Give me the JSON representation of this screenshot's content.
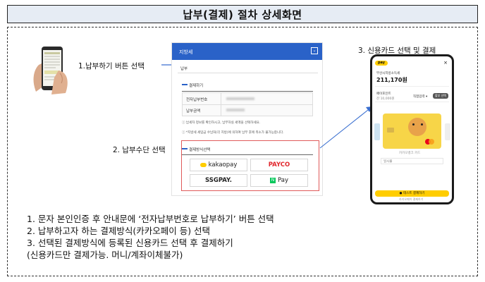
{
  "title": "납부(결제) 절차 상세화면",
  "labels": {
    "step1": "1.납부하기 버튼 선택",
    "step2": "2. 납부수단 선택",
    "step3": "3. 신용카드 선택 및 결제"
  },
  "screen_a": {
    "header": "지방세",
    "section": "납부",
    "subsection": "결제하기",
    "row1_label": "전자납부번호",
    "row2_label": "납부금액",
    "notice1": "ⓘ 납세자 정보를 확인하시고, 납부하실 세액을 선택하세요.",
    "notice2": "ⓘ *지방세 세입금 수납처(각 지방)에 의하여 납부 후에 취소가 불가능합니다.",
    "method_title": "결제방식선택",
    "methods": [
      "kakaopay",
      "PAYCO",
      "SSGPAY.",
      "Pay"
    ]
  },
  "screen_b": {
    "brand": "pay",
    "payee": "부산시지방소득세",
    "amount": "211,170원",
    "point_label": "페이포인트",
    "point_value": "잔 10,000원",
    "setting_label": "직접입력 ▾",
    "option_btn": "할부 선택",
    "card_hint": "카카오뱅크 카드",
    "install": "일시불",
    "pay_btn": "● 테스트 결제하기",
    "footer": "카카오페이 결제하기"
  },
  "steps": [
    "1.   문자 본인인증 후 안내문에 ‘전자납부번호로 납부하기’ 버튼 선택",
    "2.   납부하고자 하는 결제방식(카카오페이 등) 선택",
    "3.   선택된 결제방식에 등록된 신용카드 선택 후 결제하기",
    "      (신용카드만 결제가능. 머니/계좌이체불가)"
  ]
}
